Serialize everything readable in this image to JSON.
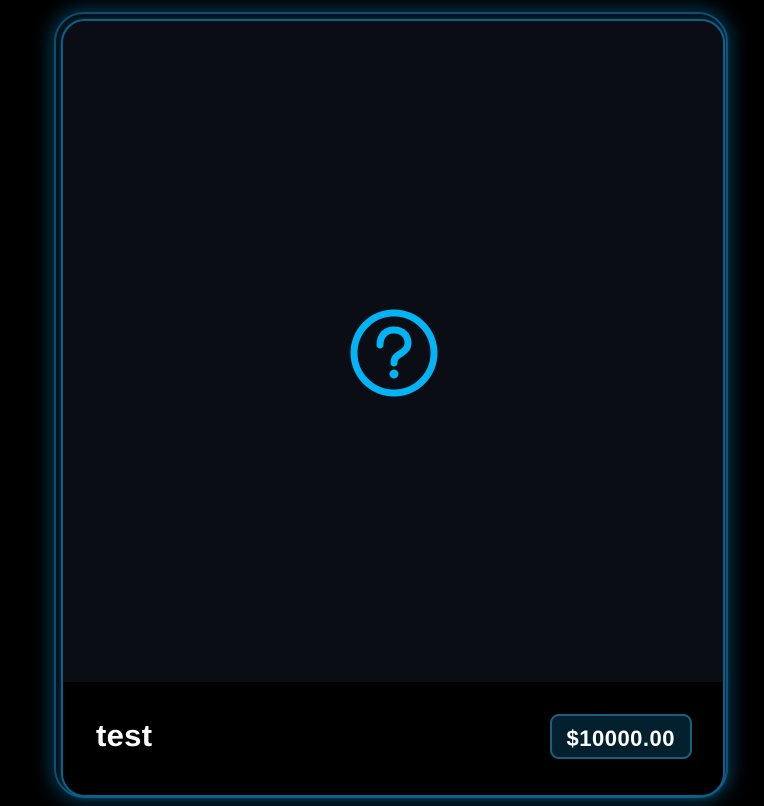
{
  "product_card": {
    "image_placeholder_icon": "question-circle-icon",
    "title": "test",
    "price": "$10000.00"
  },
  "colors": {
    "page_background": "#000000",
    "card_background": "#0a0d14",
    "footer_background": "#000000",
    "accent": "#00b4f5",
    "border": "#0e5f8c",
    "badge_background": "#03202e",
    "text": "#ffffff"
  }
}
